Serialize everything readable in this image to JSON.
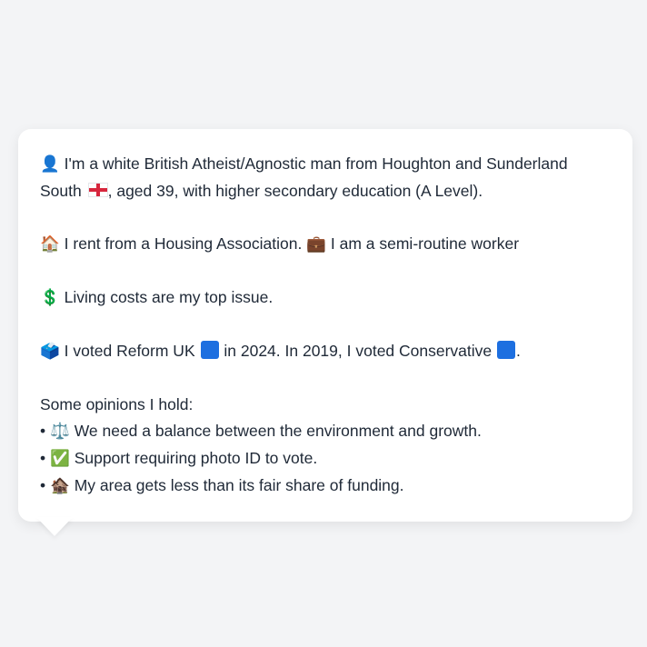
{
  "profile": {
    "identity_icon": "👤",
    "identity_text_1": "I'm a white British Atheist/Agnostic man from Houghton and Sunderland South",
    "flag_icon": "england-flag-icon",
    "identity_text_2": ", aged 39, with higher secondary education (A Level).",
    "housing_icon": "🏠",
    "housing_text": "I rent from a Housing Association.",
    "work_icon": "💼",
    "work_text": "I am a semi-routine worker",
    "issue_icon": "💲",
    "issue_text": "Living costs are my top issue.",
    "vote_icon": "🗳️",
    "vote_text_1": "I voted Reform UK",
    "vote_text_2": "in 2024. In 2019, I voted Conservative",
    "vote_text_3": ".",
    "party_color": "#1d6fe0",
    "opinions_heading": "Some opinions I hold:",
    "opinions": [
      {
        "bullet": "•",
        "icon": "⚖️",
        "text": "We need a balance between the environment and growth."
      },
      {
        "bullet": "•",
        "icon": "✅",
        "text": "Support requiring photo ID to vote."
      },
      {
        "bullet": "•",
        "icon": "🏚️",
        "text": "My area gets less than its fair share of funding."
      }
    ]
  }
}
